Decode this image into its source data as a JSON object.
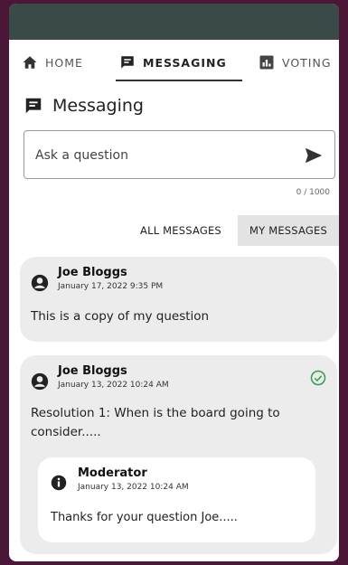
{
  "tabs": [
    {
      "label": "HOME",
      "icon": "home-icon"
    },
    {
      "label": "MESSAGING",
      "icon": "chat-icon",
      "active": true
    },
    {
      "label": "VOTING",
      "icon": "bar-chart-icon"
    }
  ],
  "section": {
    "title": "Messaging"
  },
  "ask": {
    "placeholder": "Ask a question",
    "counter": "0 / 1000"
  },
  "filters": {
    "all": "ALL MESSAGES",
    "mine": "MY MESSAGES",
    "selected": "MY MESSAGES"
  },
  "messages": [
    {
      "author": "Joe Bloggs",
      "date": "January 17, 2022 9:35 PM",
      "text": "This is a copy of my question"
    },
    {
      "author": "Joe Bloggs",
      "date": "January 13, 2022 10:24 AM",
      "text": "Resolution 1: When is the board going to consider.....",
      "answered": true,
      "reply": {
        "author": "Moderator",
        "date": "January 13, 2022 10:24 AM",
        "text": "Thanks for your question Joe....."
      }
    }
  ],
  "colors": {
    "frame": "#4a1737",
    "topbar": "#3a4a48",
    "check": "#2e9e4f",
    "card": "#ececec"
  }
}
